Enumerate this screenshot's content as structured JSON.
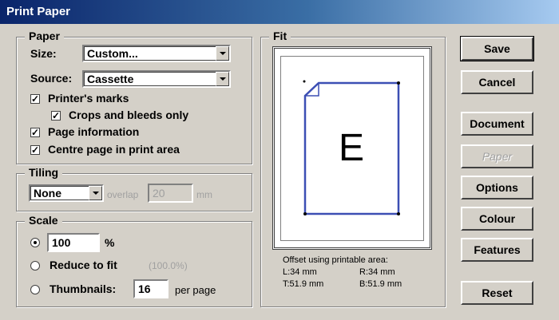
{
  "window": {
    "title": "Print Paper"
  },
  "paper": {
    "legend": "Paper",
    "size_label": "Size:",
    "size_value": "Custom...",
    "source_label": "Source:",
    "source_value": "Cassette",
    "printers_marks": {
      "label": "Printer's marks",
      "checked": true
    },
    "crops_and_bleeds": {
      "label": "Crops and bleeds only",
      "checked": true
    },
    "page_information": {
      "label": "Page information",
      "checked": true
    },
    "centre_page": {
      "label": "Centre page in print area",
      "checked": true
    }
  },
  "tiling": {
    "legend": "Tiling",
    "mode_value": "None",
    "overlap_label": "overlap",
    "overlap_value": "20",
    "overlap_unit": "mm"
  },
  "scale": {
    "legend": "Scale",
    "percent_value": "100",
    "percent_unit": "%",
    "reduce_label": "Reduce to fit",
    "reduce_value": "(100.0%)",
    "thumbnails_label": "Thumbnails:",
    "thumbnails_value": "16",
    "per_page_label": "per page",
    "selected": "percent"
  },
  "fit": {
    "legend": "Fit",
    "page_letter": "E",
    "offset_title": "Offset using printable area:",
    "left": "L:34 mm",
    "right": "R:34 mm",
    "top": "T:51.9 mm",
    "bottom": "B:51.9 mm"
  },
  "buttons": {
    "save": "Save",
    "cancel": "Cancel",
    "document": "Document",
    "paper": "Paper",
    "options": "Options",
    "colour": "Colour",
    "features": "Features",
    "reset": "Reset"
  },
  "colors": {
    "title_bar": "#0a246a",
    "page_outline": "#3c4fb4",
    "dialog_face": "#d4d0c8"
  }
}
